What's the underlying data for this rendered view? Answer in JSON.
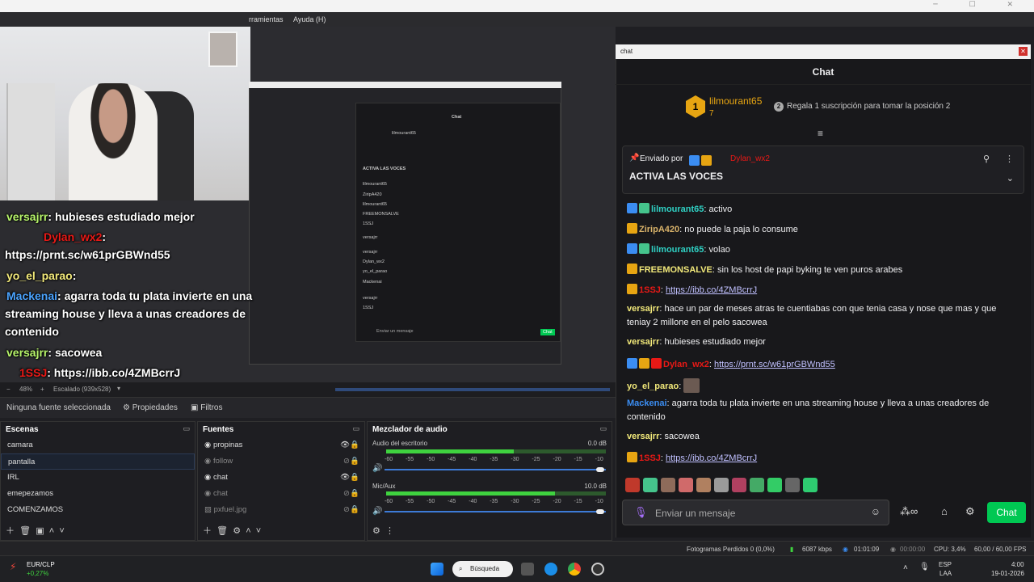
{
  "obs": {
    "menu_label": "rramientas",
    "menu_help": "Ayuda (H)",
    "zoom": "48%",
    "scale_label": "Escalado (939x528)",
    "no_source": "Ninguna fuente seleccionada",
    "properties": "Propiedades",
    "filters": "Filtros"
  },
  "overlay_chat": [
    {
      "user": "versajrr",
      "text": ": hubieses estudiado mejor"
    },
    {
      "user": "Dylan_wx2",
      "text": ":"
    },
    {
      "user": "",
      "text": "https://prnt.sc/w61prGBWnd55"
    },
    {
      "user": "yo_el_parao",
      "text": ":"
    },
    {
      "user": "Mackenai",
      "text": ": agarra toda tu plata invierte en una"
    },
    {
      "user": "",
      "text": "streaming house y lleva a unas creadores de"
    },
    {
      "user": "",
      "text": "contenido"
    },
    {
      "user": "versajrr",
      "text": ": sacowea"
    },
    {
      "user": "1SSJ",
      "text": ": https://ibb.co/4ZMBcrrJ"
    }
  ],
  "scenes": {
    "title": "Escenas",
    "items": [
      "camara",
      "pantalla",
      "IRL",
      "emepezamos",
      "COMENZAMOS"
    ],
    "selected": 1
  },
  "sources": {
    "title": "Fuentes",
    "items": [
      "propinas",
      "follow",
      "chat",
      "chat",
      "pxfuel.jpg"
    ]
  },
  "mixer": {
    "title": "Mezclador de audio",
    "channels": [
      {
        "name": "Audio del escritorio",
        "db": "0.0 dB",
        "level": 0.58
      },
      {
        "name": "Mic/Aux",
        "db": "10.0 dB",
        "level": 0.77
      }
    ],
    "ticks": "-60 -55 -50 -45 -40 -35 -30 -25 -20 -15 -10 -5 0"
  },
  "chat": {
    "window_title": "chat",
    "header": "Chat",
    "top_gifter": {
      "name": "lilmourant65",
      "count": "7",
      "gift_text": "Regala 1 suscripción para tomar la posición 2"
    },
    "pinned_by_label": "Enviado por",
    "pinned_by": "Dylan_wx2",
    "pinned_text": "ACTIVA LAS VOCES",
    "messages": [
      {
        "user": "lilmourant65",
        "text": ": activo"
      },
      {
        "user": "ZiripA420",
        "text": ": no puede la paja lo consume"
      },
      {
        "user": "lilmourant65",
        "text": ": volao"
      },
      {
        "user": "FREEMONSALVE",
        "text": ": sin los host de papi byking te ven puros arabes"
      },
      {
        "user": "1SSJ",
        "text": ": ",
        "link": "https://ibb.co/4ZMBcrrJ"
      },
      {
        "user": "versajrr",
        "text": ": hace un par de meses atras te cuentiabas con que tenia casa y nose que mas y que",
        "text2": "teniay 2 millone en el pelo sacowea"
      },
      {
        "user": "versajrr",
        "text": ": hubieses estudiado mejor"
      },
      {
        "user": "Dylan_wx2",
        "text": ": ",
        "link": "https://prnt.sc/w61prGBWnd55"
      },
      {
        "user": "yo_el_parao",
        "text": ":"
      },
      {
        "user": "Mackenai",
        "text": ": agarra toda tu plata invierte en una streaming house y lleva a unas creadores de",
        "text2": "contenido"
      },
      {
        "user": "versajrr",
        "text": ": sacowea"
      },
      {
        "user": "1SSJ",
        "text": ": ",
        "link": "https://ibb.co/4ZMBcrrJ"
      }
    ],
    "input_placeholder": "Enviar un mensaje",
    "send_label": "Chat"
  },
  "status": {
    "dropped": "Fotogramas Perdidos 0 (0,0%)",
    "kbps": "6087 kbps",
    "live_time": "01:01:09",
    "rec_time": "00:00:00",
    "cpu": "CPU: 3,4%",
    "fps": "60,00 / 60,00 FPS"
  },
  "taskbar": {
    "ticker_name": "EUR/CLP",
    "ticker_change": "+0,27%",
    "search": "Búsqueda",
    "lang1": "ESP",
    "lang2": "LAA",
    "time": "4:00",
    "date": "19-01-2026"
  },
  "colors": {
    "accent_green": "#00c853",
    "chat_bg": "#18181b",
    "obs_bg": "#1f1f23"
  }
}
